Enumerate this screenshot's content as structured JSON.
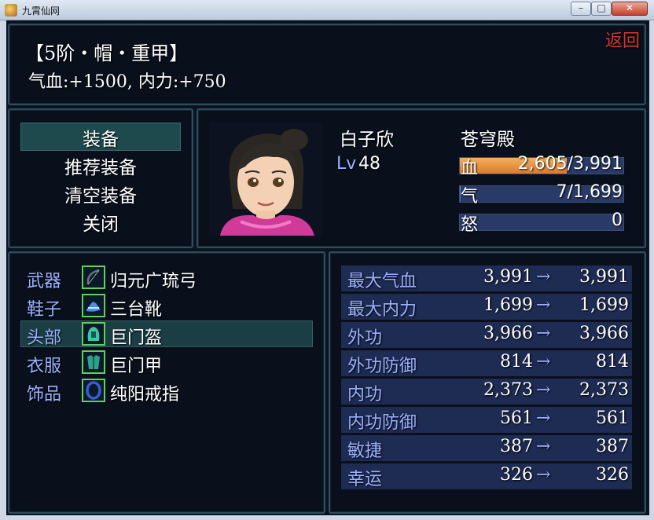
{
  "window": {
    "title": "九霄仙网",
    "minimize": "–",
    "maximize": "□",
    "close": "✕"
  },
  "item": {
    "name": "【5阶・帽・重甲】",
    "stats": "气血:+1500, 内力:+750",
    "back_label": "返回"
  },
  "menu": {
    "items": [
      "装备",
      "推荐装备",
      "清空装备",
      "关闭"
    ],
    "selected_index": 0
  },
  "character": {
    "name": "白子欣",
    "faction": "苍穹殿",
    "level_label": "Lv",
    "level": "48",
    "hp": {
      "label": "血",
      "value": "2,605/3,991",
      "fraction": 0.653
    },
    "mp": {
      "label": "气",
      "value": "7/1,699",
      "fraction": 0.004
    },
    "rage": {
      "label": "怒",
      "value": "0",
      "fraction": 0
    }
  },
  "equipment": {
    "selected_index": 2,
    "slots": [
      {
        "label": "武器",
        "item": "归元广琉弓",
        "icon": "bow-icon"
      },
      {
        "label": "鞋子",
        "item": "三台靴",
        "icon": "boots-icon"
      },
      {
        "label": "头部",
        "item": "巨门盔",
        "icon": "helmet-icon"
      },
      {
        "label": "衣服",
        "item": "巨门甲",
        "icon": "armor-icon"
      },
      {
        "label": "饰品",
        "item": "纯阳戒指",
        "icon": "ring-icon"
      }
    ]
  },
  "stats": {
    "arrow": "→",
    "rows": [
      {
        "name": "最大气血",
        "current": "3,991",
        "new": "3,991"
      },
      {
        "name": "最大内力",
        "current": "1,699",
        "new": "1,699"
      },
      {
        "name": "外功",
        "current": "3,966",
        "new": "3,966"
      },
      {
        "name": "外功防御",
        "current": "814",
        "new": "814"
      },
      {
        "name": "内功",
        "current": "2,373",
        "new": "2,373"
      },
      {
        "name": "内功防御",
        "current": "561",
        "new": "561"
      },
      {
        "name": "敏捷",
        "current": "387",
        "new": "387"
      },
      {
        "name": "幸运",
        "current": "326",
        "new": "326"
      }
    ]
  },
  "colors": {
    "panel_border": "#2d4e5e",
    "highlight_label": "#9ab0ff",
    "back_button": "#d8332c",
    "hp_bar": "#e08a3a",
    "equip_icon_border": "#5fcf5f"
  }
}
